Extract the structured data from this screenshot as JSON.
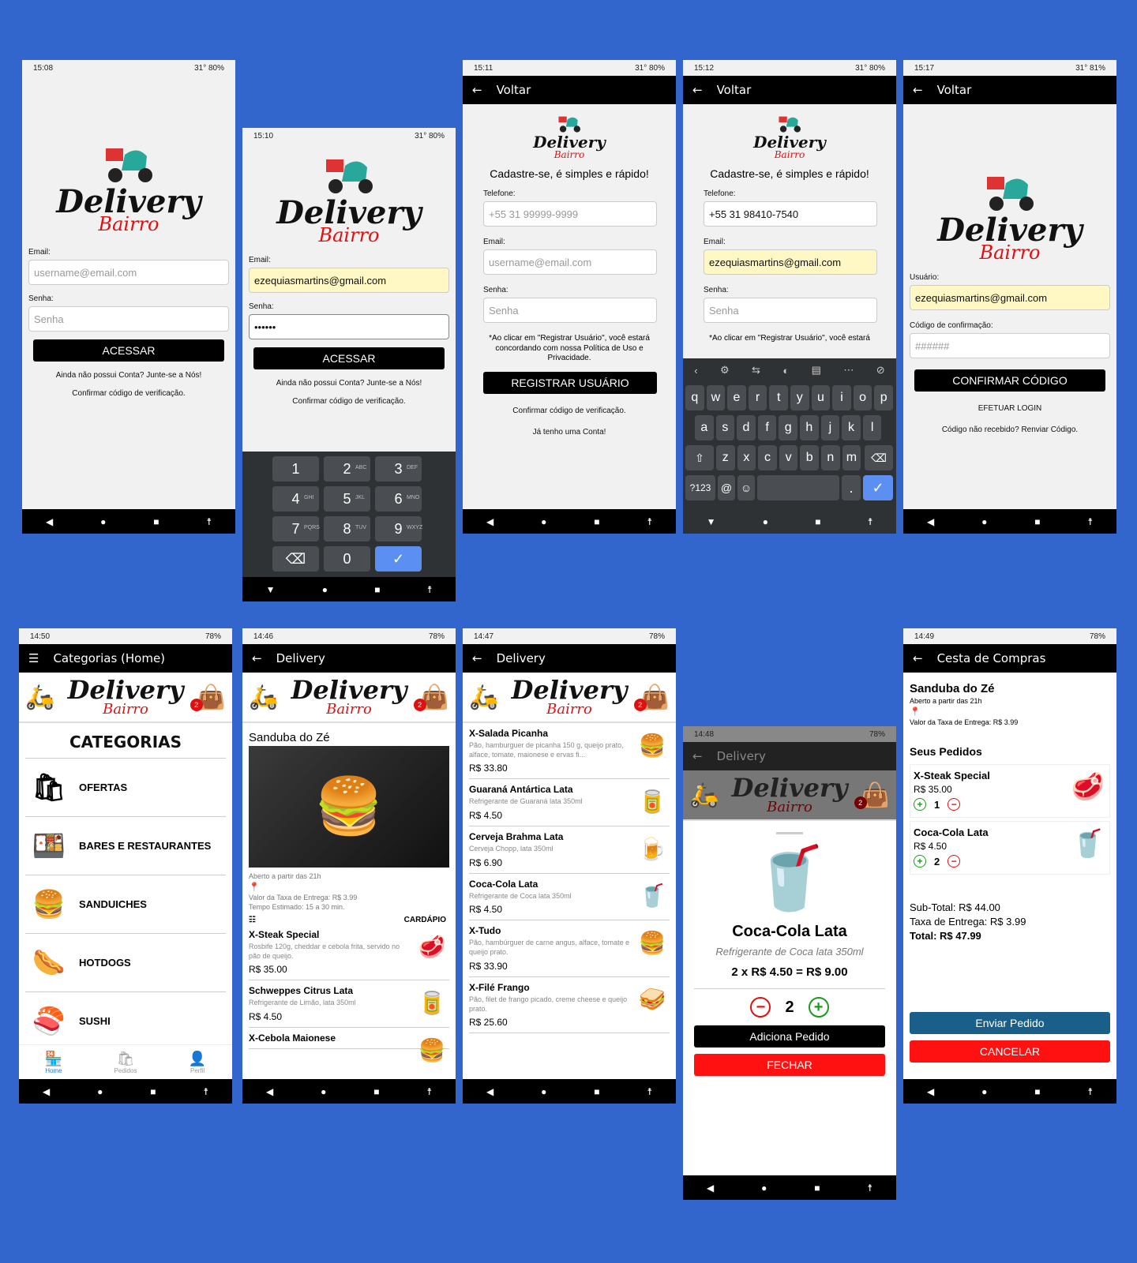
{
  "colors": {
    "background": "#3366cc",
    "accent_red": "#e01010",
    "appbar": "#000000",
    "send_button": "#1a5f8a"
  },
  "s1": {
    "time": "15:08",
    "status": "31° 80%",
    "email_label": "Email:",
    "email_placeholder": "username@email.com",
    "senha_label": "Senha:",
    "senha_placeholder": "Senha",
    "btn": "ACESSAR",
    "link1": "Ainda não possui Conta? Junte-se a Nós!",
    "link2": "Confirmar código de verificação."
  },
  "logo": {
    "d": "Delivery",
    "b": "Bairro"
  },
  "s2": {
    "time": "15:10",
    "status": "31° 80%",
    "email_label": "Email:",
    "email_value": "ezequiasmartins@gmail.com",
    "senha_label": "Senha:",
    "senha_value": "••••••",
    "btn": "ACESSAR",
    "link1": "Ainda não possui Conta? Junte-se a Nós!",
    "link2": "Confirmar código de verificação.",
    "keys": [
      {
        "n": "1",
        "l": ""
      },
      {
        "n": "2",
        "l": "ABC"
      },
      {
        "n": "3",
        "l": "DEF"
      },
      {
        "n": "4",
        "l": "GHI"
      },
      {
        "n": "5",
        "l": "JKL"
      },
      {
        "n": "6",
        "l": "MNO"
      },
      {
        "n": "7",
        "l": "PQRS"
      },
      {
        "n": "8",
        "l": "TUV"
      },
      {
        "n": "9",
        "l": "WXYZ"
      },
      {
        "n": "⌫",
        "l": ""
      },
      {
        "n": "0",
        "l": ""
      },
      {
        "n": "✓",
        "l": ""
      }
    ]
  },
  "s3": {
    "time": "15:11",
    "status": "31° 80%",
    "back": "Voltar",
    "headline": "Cadastre-se, é simples e rápido!",
    "tel_label": "Telefone:",
    "tel_placeholder": "+55 31 99999-9999",
    "email_label": "Email:",
    "email_placeholder": "username@email.com",
    "senha_label": "Senha:",
    "senha_placeholder": "Senha",
    "notice": "*Ao clicar em \"Registrar Usuário\", você estará concordando com nossa Política de Uso e Privacidade.",
    "btn": "REGISTRAR USUÁRIO",
    "link1": "Confirmar código de verificação.",
    "link2": "Já tenho uma Conta!"
  },
  "s4": {
    "time": "15:12",
    "status": "31° 80%",
    "back": "Voltar",
    "headline": "Cadastre-se, é simples e rápido!",
    "tel_label": "Telefone:",
    "tel_value": "+55 31 98410-7540",
    "email_label": "Email:",
    "email_value": "ezequiasmartins@gmail.com",
    "senha_label": "Senha:",
    "senha_placeholder": "Senha",
    "notice": "*Ao clicar em \"Registrar Usuário\", você estará",
    "row1": [
      "q",
      "w",
      "e",
      "r",
      "t",
      "y",
      "u",
      "i",
      "o",
      "p"
    ],
    "row2": [
      "a",
      "s",
      "d",
      "f",
      "g",
      "h",
      "j",
      "k",
      "l"
    ],
    "row3": [
      "z",
      "x",
      "c",
      "v",
      "b",
      "n",
      "m"
    ],
    "sym": "?123"
  },
  "s5": {
    "time": "15:17",
    "status": "31° 81%",
    "back": "Voltar",
    "user_label": "Usuário:",
    "user_value": "ezequiasmartins@gmail.com",
    "code_label": "Código de confirmação:",
    "code_placeholder": "######",
    "btn": "CONFIRMAR CÓDIGO",
    "link1": "EFETUAR LOGIN",
    "link2": "Código não recebido? Renviar Código."
  },
  "s6": {
    "time": "14:50",
    "status": "78%",
    "title": "Categorias (Home)",
    "heading": "CATEGORIAS",
    "badge": "2",
    "cats": [
      {
        "label": "OFERTAS",
        "icon": "🛍"
      },
      {
        "label": "BARES E RESTAURANTES",
        "icon": "🍱"
      },
      {
        "label": "SANDUICHES",
        "icon": "🍔"
      },
      {
        "label": "HOTDOGS",
        "icon": "🌭"
      },
      {
        "label": "SUSHI",
        "icon": "🍣"
      }
    ],
    "tabs": [
      "Home",
      "Pedidos",
      "Perfil"
    ]
  },
  "s7": {
    "time": "14:46",
    "status": "78%",
    "title": "Delivery",
    "badge": "2",
    "store": "Sanduba do Zé",
    "open": "Aberto a partir das 21h",
    "fee": "Valor da Taxa de Entrega: R$ 3.99",
    "eta": "Tempo Estimado: 15 a 30 min.",
    "menu": "CARDÁPIO",
    "items": [
      {
        "t": "X-Steak Special",
        "s": "Rosbife 120g, cheddar e cebola frita, servido no pão de queijo.",
        "p": "R$ 35.00",
        "i": "🥩"
      },
      {
        "t": "Schweppes Citrus Lata",
        "s": "Refrigerante de Limão, lata 350ml",
        "p": "R$ 4.50",
        "i": "🥫"
      },
      {
        "t": "X-Cebola Maionese",
        "s": "",
        "p": "",
        "i": "🍔"
      }
    ]
  },
  "s8": {
    "time": "14:47",
    "status": "78%",
    "title": "Delivery",
    "badge": "2",
    "items": [
      {
        "t": "X-Salada Picanha",
        "s": "Pão, hamburguer de picanha 150 g, queijo prato, alface, tomate, maionese e ervas fi...",
        "p": "R$ 33.80",
        "i": "🍔"
      },
      {
        "t": "Guaraná Antártica Lata",
        "s": "Refrigerante de Guaraná lata 350ml",
        "p": "R$ 4.50",
        "i": "🥫"
      },
      {
        "t": "Cerveja Brahma Lata",
        "s": "Cerveja Chopp, lata 350ml",
        "p": "R$ 6.90",
        "i": "🍺"
      },
      {
        "t": "Coca-Cola Lata",
        "s": "Refrigerante de Coca lata 350ml",
        "p": "R$ 4.50",
        "i": "🥤"
      },
      {
        "t": "X-Tudo",
        "s": "Pão, hambúrguer de carne angus, alface, tomate e queijo prato.",
        "p": "R$ 33.90",
        "i": "🍔"
      },
      {
        "t": "X-Filé Frango",
        "s": "Pão, filet de frango picado, creme cheese e queijo prato.",
        "p": "R$ 25.60",
        "i": "🥪"
      }
    ]
  },
  "s9": {
    "time": "14:48",
    "status": "78%",
    "title": "Delivery",
    "badge": "2",
    "name": "Coca-Cola Lata",
    "desc": "Refrigerante de Coca lata 350ml",
    "calc": "2 x R$ 4.50 = R$ 9.00",
    "qty": "2",
    "add": "Adiciona Pedido",
    "close": "FECHAR"
  },
  "s10": {
    "time": "14:49",
    "status": "78%",
    "title": "Cesta de Compras",
    "store": "Sanduba do Zé",
    "open": "Aberto a partir das 21h",
    "fee": "Valor da Taxa de Entrega: R$ 3.99",
    "orders_title": "Seus Pedidos",
    "orders": [
      {
        "t": "X-Steak Special",
        "p": "R$ 35.00",
        "q": "1",
        "i": "🥩"
      },
      {
        "t": "Coca-Cola Lata",
        "p": "R$ 4.50",
        "q": "2",
        "i": "🥤"
      }
    ],
    "subtotal": "Sub-Total: R$ 44.00",
    "taxa": "Taxa de Entrega: R$ 3.99",
    "total": "Total: R$ 47.99",
    "send": "Enviar Pedido",
    "cancel": "CANCELAR"
  }
}
